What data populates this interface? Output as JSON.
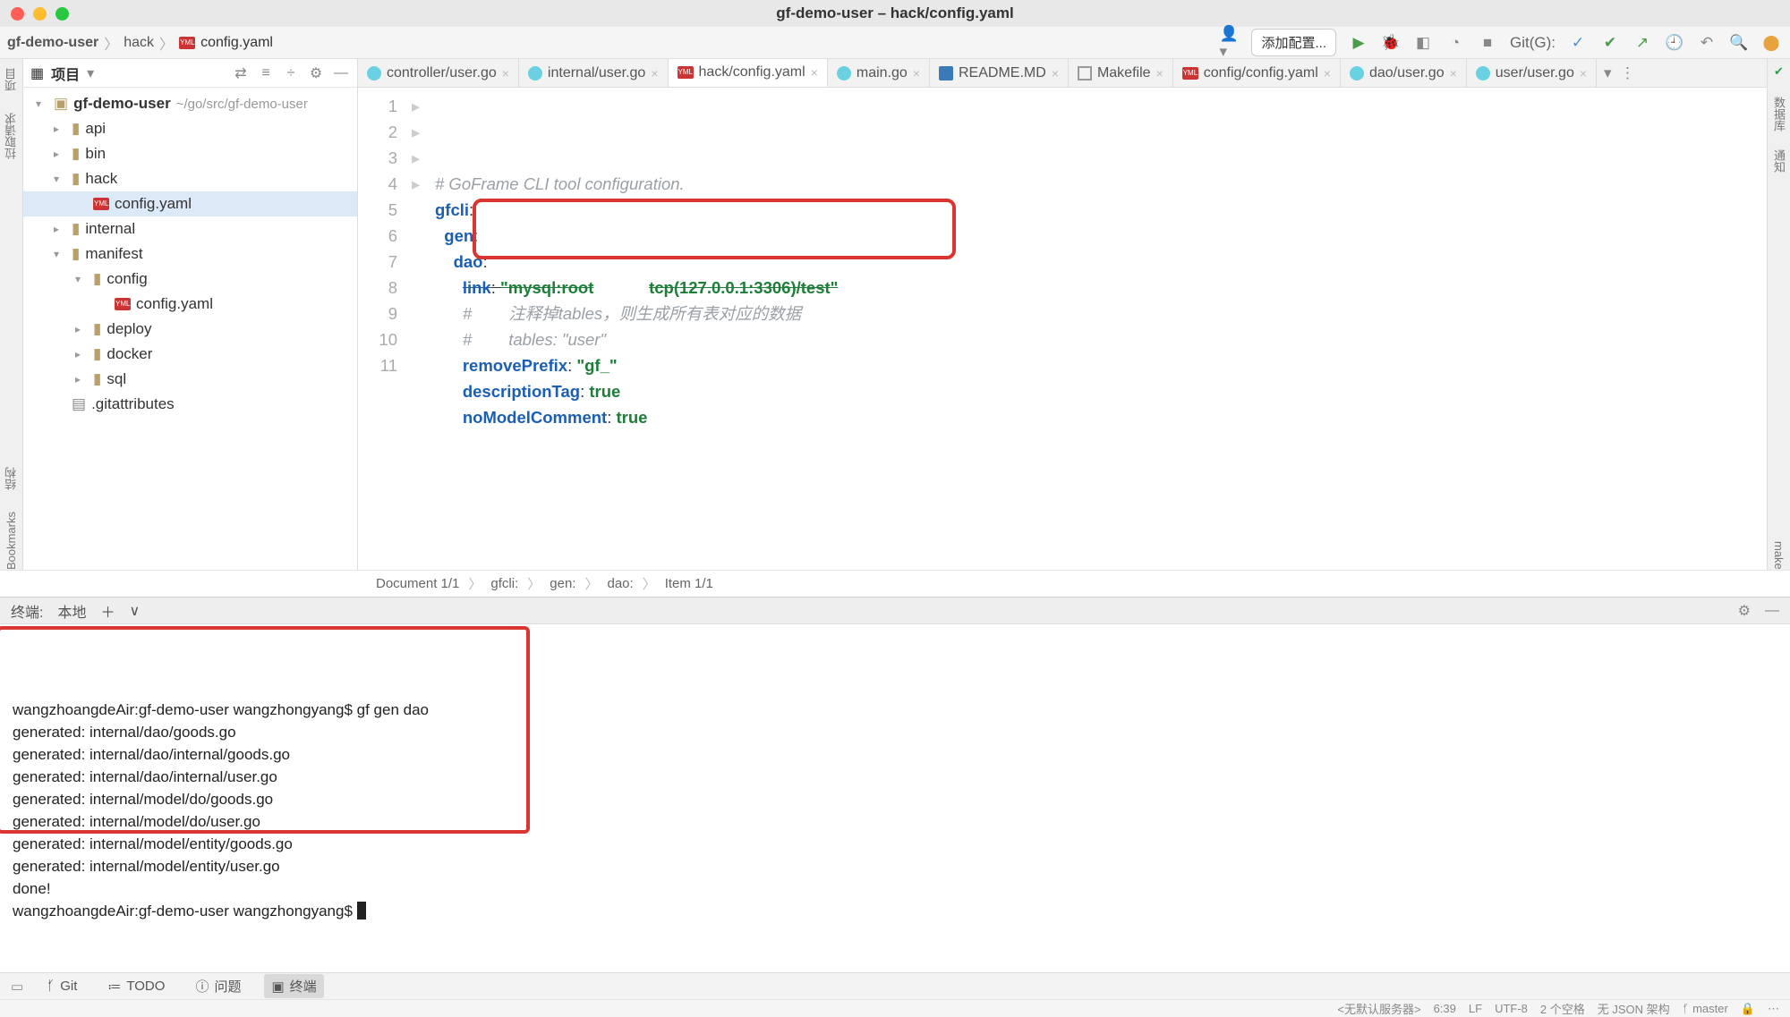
{
  "window": {
    "title": "gf-demo-user – hack/config.yaml"
  },
  "breadcrumb": {
    "root": "gf-demo-user",
    "mid": "hack",
    "file": "config.yaml"
  },
  "toolbar": {
    "addConfig": "添加配置...",
    "git": "Git(G):"
  },
  "project": {
    "panelLabel": "项目",
    "root": {
      "name": "gf-demo-user",
      "path": "~/go/src/gf-demo-user"
    },
    "nodes": [
      {
        "depth": 1,
        "type": "dir",
        "name": "api",
        "expand": ">"
      },
      {
        "depth": 1,
        "type": "dir",
        "name": "bin",
        "expand": ">"
      },
      {
        "depth": 1,
        "type": "dir",
        "name": "hack",
        "expand": "v"
      },
      {
        "depth": 2,
        "type": "yml",
        "name": "config.yaml",
        "sel": true
      },
      {
        "depth": 1,
        "type": "dir",
        "name": "internal",
        "expand": ">"
      },
      {
        "depth": 1,
        "type": "dir",
        "name": "manifest",
        "expand": "v"
      },
      {
        "depth": 2,
        "type": "dir",
        "name": "config",
        "expand": "v"
      },
      {
        "depth": 3,
        "type": "yml",
        "name": "config.yaml"
      },
      {
        "depth": 2,
        "type": "dir",
        "name": "deploy",
        "expand": ">"
      },
      {
        "depth": 2,
        "type": "dir",
        "name": "docker",
        "expand": ">"
      },
      {
        "depth": 2,
        "type": "dir",
        "name": "sql",
        "expand": ">"
      },
      {
        "depth": 1,
        "type": "file",
        "name": ".gitattributes"
      }
    ]
  },
  "tabs": [
    {
      "icon": "go",
      "label": "controller/user.go"
    },
    {
      "icon": "go",
      "label": "internal/user.go"
    },
    {
      "icon": "yml",
      "label": "hack/config.yaml",
      "active": true
    },
    {
      "icon": "go",
      "label": "main.go"
    },
    {
      "icon": "md",
      "label": "README.MD"
    },
    {
      "icon": "mk",
      "label": "Makefile"
    },
    {
      "icon": "yml",
      "label": "config/config.yaml"
    },
    {
      "icon": "go",
      "label": "dao/user.go"
    },
    {
      "icon": "go",
      "label": "user/user.go"
    }
  ],
  "code": {
    "lines": [
      {
        "n": 1,
        "html": "<span class='c-cmt'># GoFrame CLI tool configuration.</span>"
      },
      {
        "n": 2,
        "html": "<span class='c-key'>gfcli</span>:"
      },
      {
        "n": 3,
        "html": "  <span class='c-key'>gen</span>:"
      },
      {
        "n": 4,
        "html": "    <span class='c-key'>dao</span>:"
      },
      {
        "n": 5,
        "html": "      <span class='c-key c-strike'>link</span><span class='c-strike'>: </span><span class='c-str c-strike'>\"mysql:root</span>            <span class='c-str c-strike'>tcp(127.0.0.1:3306)/test\"</span>"
      },
      {
        "n": 6,
        "html": "      <span class='c-cmt'>#        注释掉tables，则生成所有表对应的数据</span>",
        "hl": true
      },
      {
        "n": 7,
        "html": "      <span class='c-cmt'>#        tables: \"user\"</span>"
      },
      {
        "n": 8,
        "html": "      <span class='c-key'>removePrefix</span>: <span class='c-str'>\"gf_\"</span>"
      },
      {
        "n": 9,
        "html": "      <span class='c-key'>descriptionTag</span>: <span class='c-str'>true</span>"
      },
      {
        "n": 10,
        "html": "      <span class='c-key'>noModelComment</span>: <span class='c-str'>true</span>"
      },
      {
        "n": 11,
        "html": ""
      }
    ]
  },
  "pathbar": [
    "Document 1/1",
    "gfcli:",
    "gen:",
    "dao:",
    "Item 1/1"
  ],
  "terminal": {
    "title": "终端:",
    "tab": "本地",
    "lines": [
      "wangzhoangdeAir:gf-demo-user wangzhongyang$ gf gen dao",
      "generated: internal/dao/goods.go",
      "generated: internal/dao/internal/goods.go",
      "generated: internal/dao/internal/user.go",
      "generated: internal/model/do/goods.go",
      "generated: internal/model/do/user.go",
      "generated: internal/model/entity/goods.go",
      "generated: internal/model/entity/user.go",
      "done!",
      "wangzhoangdeAir:gf-demo-user wangzhongyang$ "
    ]
  },
  "bottomTabs": {
    "git": "Git",
    "todo": "TODO",
    "problems": "问题",
    "terminal": "终端"
  },
  "status": {
    "server": "<无默认服务器>",
    "pos": "6:39",
    "lf": "LF",
    "enc": "UTF-8",
    "indent": "2 个空格",
    "schema": "无 JSON 架构",
    "branch": "master"
  },
  "sideTabs": {
    "structure": "结构",
    "bookmarks": "Bookmarks",
    "leftA": "拉取请求",
    "leftB": "项目",
    "rightA": "数据库",
    "rightB": "通知",
    "make": "make"
  }
}
